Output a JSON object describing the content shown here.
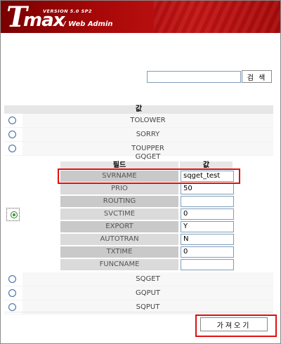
{
  "header": {
    "logo_letter": "T",
    "logo_rest": "max",
    "version": "VERSION 5.0 SP2",
    "subtitle": "/ Web Admin"
  },
  "search": {
    "value": "",
    "placeholder": "",
    "button_label": "검 색"
  },
  "list": {
    "header": "값",
    "items_top": [
      "TOLOWER",
      "SORRY",
      "TOUPPER"
    ],
    "expanded_item": "GQGET",
    "items_bottom": [
      "SQGET",
      "GQPUT",
      "SQPUT"
    ]
  },
  "subtable": {
    "col_field": "필드",
    "col_value": "값",
    "rows": [
      {
        "field": "SVRNAME",
        "value": "sqget_test"
      },
      {
        "field": "PRIO",
        "value": "50"
      },
      {
        "field": "ROUTING",
        "value": ""
      },
      {
        "field": "SVCTIME",
        "value": "0"
      },
      {
        "field": "EXPORT",
        "value": "Y"
      },
      {
        "field": "AUTOTRAN",
        "value": "N"
      },
      {
        "field": "TXTIME",
        "value": "0"
      },
      {
        "field": "FUNCNAME",
        "value": ""
      }
    ]
  },
  "actions": {
    "fetch_label": "가져오기"
  },
  "colors": {
    "header_red": "#b00c0c",
    "highlight_red": "#e01010",
    "radio_blue": "#3f6fa8",
    "radio_selected": "#2aa12a"
  }
}
